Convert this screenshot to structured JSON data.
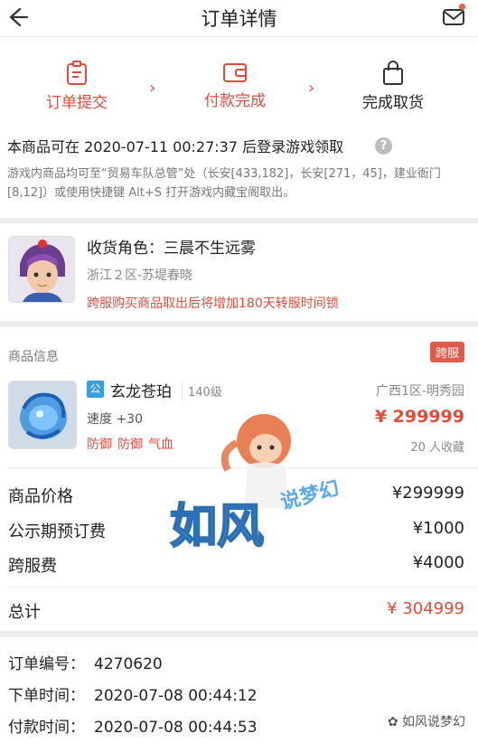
{
  "header": {
    "title": "订单详情"
  },
  "steps": [
    {
      "label": "订单提交"
    },
    {
      "label": "付款完成"
    },
    {
      "label": "完成取货"
    }
  ],
  "pickup": {
    "time_text": "本商品可在 2020-07-11 00:27:37 后登录游戏领取",
    "description": "游戏内商品均可至“贸易车队总管”处（长安[433,182]，长安[271，45]，建业衙门[8,12]）或使用快捷键 Alt+S 打开游戏内藏宝阁取出。"
  },
  "receiver": {
    "role_text": "收货角色：三晨不生远雾",
    "server": "浙江２区-苏堤春晓",
    "warning": "跨服购买商品取出后将增加180天转服时间锁"
  },
  "goods": {
    "section_label": "商品信息",
    "cross_badge": "跨服",
    "public_tag": "公",
    "name": "玄龙苍珀",
    "level": "140级",
    "speed": "速度 +30",
    "attrs": [
      "防御",
      "防御",
      "气血"
    ],
    "server": "广西1区-明秀园",
    "price": "¥ 299999",
    "favorites": "20 人收藏"
  },
  "costs": {
    "price_label": "商品价格",
    "price_value": "¥299999",
    "preorder_label": "公示期预订费",
    "preorder_value": "¥1000",
    "cross_label": "跨服费",
    "cross_value": "¥4000",
    "total_label": "总计",
    "total_value": "¥ 304999"
  },
  "order": {
    "number_label": "订单编号：",
    "number_value": "4270620",
    "created_label": "下单时间：",
    "created_value": "2020-07-08 00:44:12",
    "paid_label": "付款时间：",
    "paid_value": "2020-07-08 00:44:53"
  },
  "watermark": {
    "text1": "如风",
    "text2": "说梦幻"
  },
  "wechat_mark": "如风说梦幻",
  "colors": {
    "accent": "#e24b3b",
    "tag_blue": "#3a9ee3"
  }
}
